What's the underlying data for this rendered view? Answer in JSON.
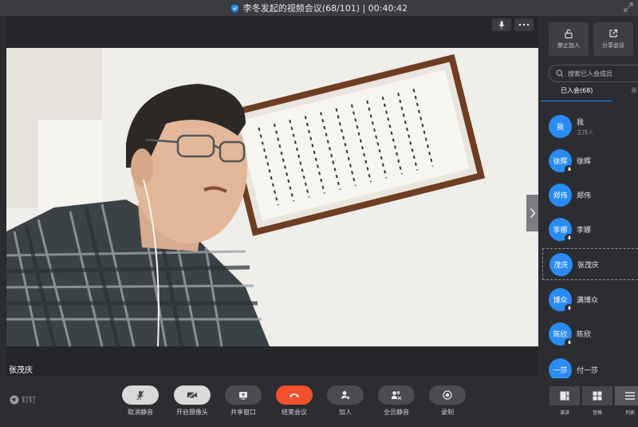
{
  "window": {
    "title": "李冬发起的视频会议(68/101) | 00:40:42"
  },
  "video": {
    "speaker_caption": "张茂庆"
  },
  "branding": {
    "logo_text": "钉钉"
  },
  "toolbar": {
    "items": [
      {
        "label": "取消静音",
        "icon": "mic-muted-icon"
      },
      {
        "label": "开启摄像头",
        "icon": "camera-off-icon"
      },
      {
        "label": "共享窗口",
        "icon": "share-screen-icon"
      },
      {
        "label": "结束会议",
        "icon": "hangup-icon"
      },
      {
        "label": "加人",
        "icon": "add-person-icon"
      },
      {
        "label": "全员静音",
        "icon": "mute-all-icon"
      },
      {
        "label": "录制",
        "icon": "record-icon"
      }
    ],
    "views": [
      {
        "label": "演讲",
        "icon": "speaker-view-icon"
      },
      {
        "label": "宫格",
        "icon": "grid-view-icon"
      },
      {
        "label": "列表",
        "icon": "list-view-icon"
      }
    ]
  },
  "sidebar": {
    "lock_label": "禁止加入",
    "share_label": "分享会议",
    "search_placeholder": "搜索已入会成员",
    "tabs": [
      {
        "label": "已入会(68)",
        "active": true
      },
      {
        "label": "未"
      }
    ],
    "members": [
      {
        "avatar": "我",
        "name": "我",
        "role": "主持人"
      },
      {
        "avatar": "徐辉",
        "name": "徐辉"
      },
      {
        "avatar": "郑伟",
        "name": "郑伟"
      },
      {
        "avatar": "李娜",
        "name": "李娜"
      },
      {
        "avatar": "茂庆",
        "name": "张茂庆"
      },
      {
        "avatar": "博众",
        "name": "满博众"
      },
      {
        "avatar": "陈欣",
        "name": "陈欣"
      },
      {
        "avatar": "一莎",
        "name": "付一莎"
      }
    ]
  },
  "colors": {
    "accent": "#2a8bf2",
    "end_call": "#f2512b",
    "background": "#2b2d31"
  }
}
